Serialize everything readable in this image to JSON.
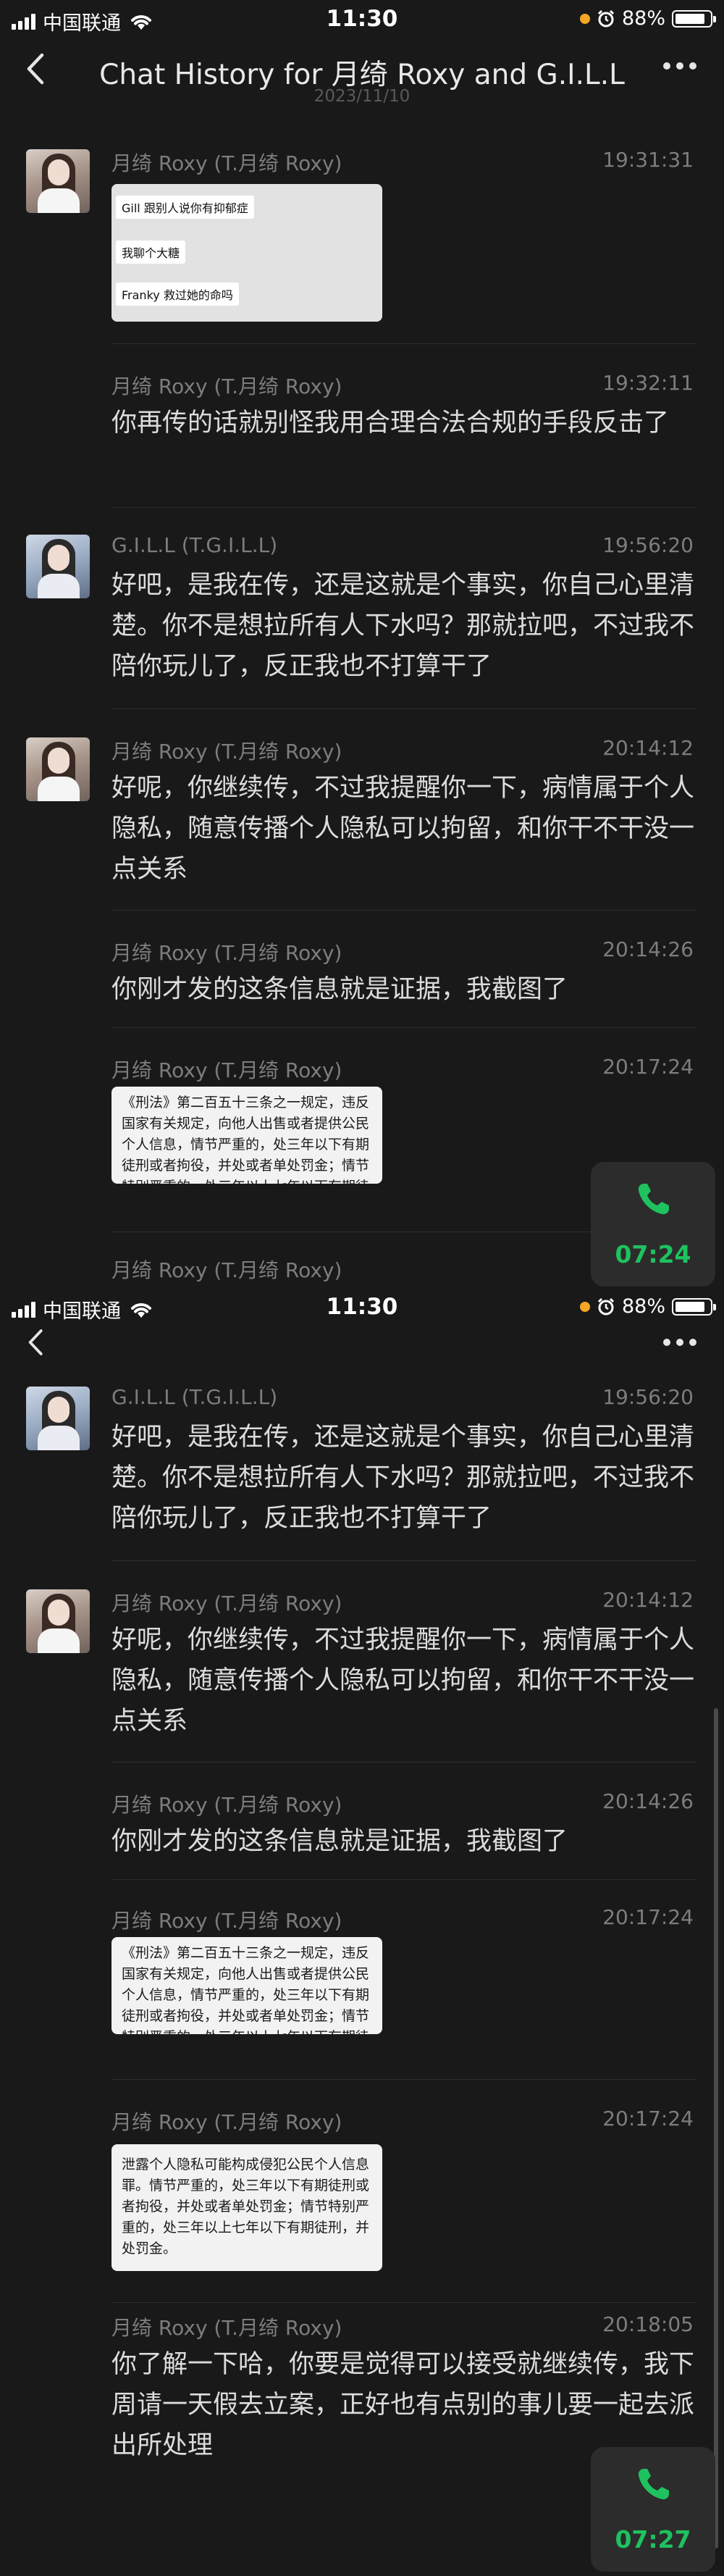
{
  "status_bar": {
    "carrier": "中国联通",
    "time": "11:30",
    "battery": "88%"
  },
  "header": {
    "title": "Chat History for 月绮 Roxy and G.I.L.L",
    "date": "2023/11/10"
  },
  "screens": [
    {
      "messages": [
        {
          "sender": "月绮 Roxy (T.月绮 Roxy)",
          "time": "19:31:31",
          "image_lines": [
            "Gill 跟别人说你有抑郁症",
            "我聊个大糖",
            "Franky 救过她的命吗"
          ]
        },
        {
          "sender": "月绮 Roxy (T.月绮 Roxy)",
          "time": "19:32:11",
          "text": "你再传的话就别怪我用合理合法合规的手段反击了"
        },
        {
          "sender": "G.I.L.L (T.G.I.L.L)",
          "time": "19:56:20",
          "text": "好吧，是我在传，还是这就是个事实，你自己心里清楚。你不是想拉所有人下水吗？那就拉吧，不过我不陪你玩儿了，反正我也不打算干了"
        },
        {
          "sender": "月绮 Roxy (T.月绮 Roxy)",
          "time": "20:14:12",
          "text": "好呢，你继续传，不过我提醒你一下，病情属于个人隐私，随意传播个人隐私可以拘留，和你干不干没一点关系"
        },
        {
          "sender": "月绮 Roxy (T.月绮 Roxy)",
          "time": "20:14:26",
          "text": "你刚才发的这条信息就是证据，我截图了"
        },
        {
          "sender": "月绮 Roxy (T.月绮 Roxy)",
          "time": "20:17:24",
          "doc": "《刑法》第二百五十三条之一规定，违反国家有关规定，向他人出售或者提供公民个人信息，情节严重的，处三年以下有期徒刑或者拘役，并处或者单处罚金；情节特别严重的，处三年以上七年以下有期徒刑，并处罚金。"
        },
        {
          "sender": "月绮 Roxy (T.月绮 Roxy)",
          "time": ""
        }
      ],
      "call_duration": "07:24"
    },
    {
      "messages": [
        {
          "sender": "G.I.L.L (T.G.I.L.L)",
          "time": "19:56:20",
          "text": "好吧，是我在传，还是这就是个事实，你自己心里清楚。你不是想拉所有人下水吗？那就拉吧，不过我不陪你玩儿了，反正我也不打算干了"
        },
        {
          "sender": "月绮 Roxy (T.月绮 Roxy)",
          "time": "20:14:12",
          "text": "好呢，你继续传，不过我提醒你一下，病情属于个人隐私，随意传播个人隐私可以拘留，和你干不干没一点关系"
        },
        {
          "sender": "月绮 Roxy (T.月绮 Roxy)",
          "time": "20:14:26",
          "text": "你刚才发的这条信息就是证据，我截图了"
        },
        {
          "sender": "月绮 Roxy (T.月绮 Roxy)",
          "time": "20:17:24",
          "doc": "《刑法》第二百五十三条之一规定，违反国家有关规定，向他人出售或者提供公民个人信息，情节严重的，处三年以下有期徒刑或者拘役，并处或者单处罚金；情节特别严重的，处三年以上七年以下有期徒刑，并处罚金。"
        },
        {
          "sender": "月绮 Roxy (T.月绮 Roxy)",
          "time": "20:17:24",
          "doc": "泄露个人隐私可能构成侵犯公民个人信息罪。情节严重的，处三年以下有期徒刑或者拘役，并处或者单处罚金；情节特别严重的，处三年以上七年以下有期徒刑，并处罚金。"
        },
        {
          "sender": "月绮 Roxy (T.月绮 Roxy)",
          "time": "20:18:05",
          "text": "你了解一下哈，你要是觉得可以接受就继续传，我下周请一天假去立案，正好也有点别的事儿要一起去派出所处理"
        }
      ],
      "call_duration": "07:27"
    }
  ]
}
